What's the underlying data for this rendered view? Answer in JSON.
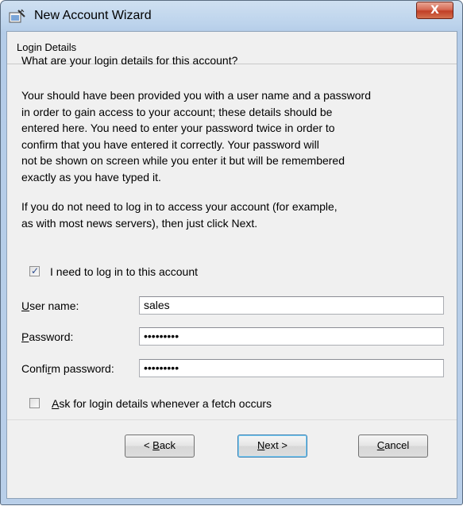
{
  "window": {
    "title": "New Account Wizard",
    "close_label": "X"
  },
  "header": {
    "title": "Login Details"
  },
  "content": {
    "question": "What are your login details for this account?",
    "paragraph1": "Your should have been provided you with a user name and a password\nin order to gain access to your account;  these details should be\nentered here.  You need to enter your password twice in order to\nconfirm that you have entered it correctly.  Your password will\nnot be shown on screen while you enter it but will be remembered\nexactly as you have typed it.",
    "paragraph2": "If you do not need to log in to access your account (for example,\nas with most news servers), then just click Next."
  },
  "login_checkbox": {
    "label": "I need to log in to this account",
    "checked": true
  },
  "fields": {
    "username": {
      "label_underlined": "U",
      "label_rest": "ser name:",
      "value": "sales"
    },
    "password": {
      "label_underlined": "P",
      "label_rest": "assword:",
      "value": "•••••••••"
    },
    "confirm": {
      "label_pre": "Confi",
      "label_underlined": "r",
      "label_rest": "m password:",
      "value": "•••••••••"
    }
  },
  "ask_checkbox": {
    "label_underlined": "A",
    "label_rest": "sk for login details whenever a fetch occurs",
    "checked": false
  },
  "buttons": {
    "back": {
      "pre": "< ",
      "underlined": "B",
      "rest": "ack"
    },
    "next": {
      "underlined": "N",
      "rest": "ext >"
    },
    "cancel": {
      "underlined": "C",
      "rest": "ancel"
    }
  }
}
